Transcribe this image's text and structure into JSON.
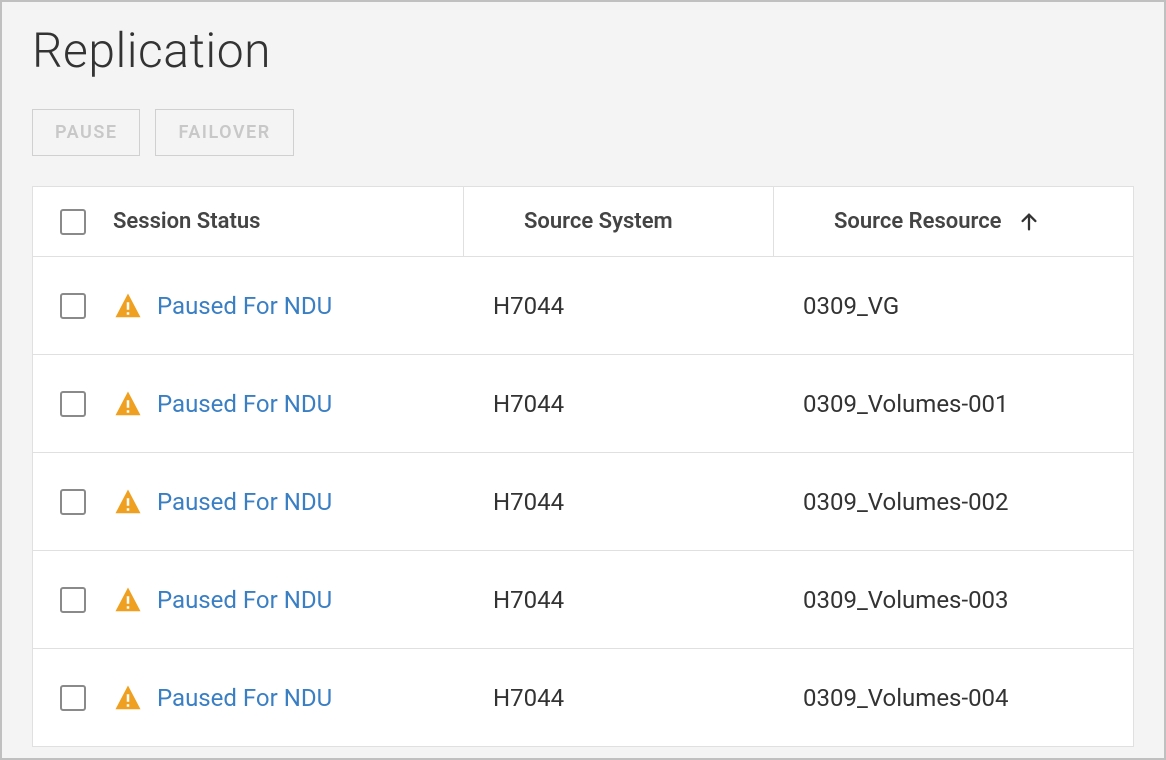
{
  "page": {
    "title": "Replication"
  },
  "toolbar": {
    "pause_label": "PAUSE",
    "failover_label": "FAILOVER"
  },
  "table": {
    "headers": {
      "session_status": "Session Status",
      "source_system": "Source System",
      "source_resource": "Source Resource"
    },
    "rows": [
      {
        "status": "Paused For NDU",
        "source_system": "H7044",
        "source_resource": "0309_VG"
      },
      {
        "status": "Paused For NDU",
        "source_system": "H7044",
        "source_resource": "0309_Volumes-001"
      },
      {
        "status": "Paused For NDU",
        "source_system": "H7044",
        "source_resource": "0309_Volumes-002"
      },
      {
        "status": "Paused For NDU",
        "source_system": "H7044",
        "source_resource": "0309_Volumes-003"
      },
      {
        "status": "Paused For NDU",
        "source_system": "H7044",
        "source_resource": "0309_Volumes-004"
      }
    ]
  }
}
